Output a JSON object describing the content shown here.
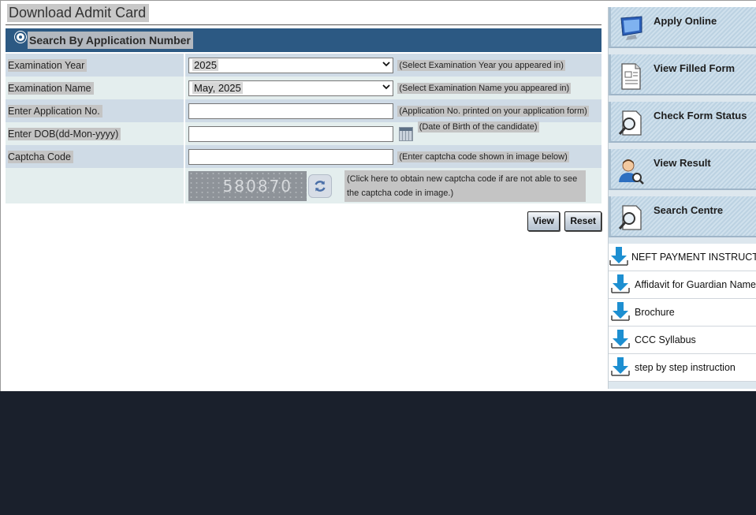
{
  "title": "Download Admit Card",
  "search_by": "Search By Application Number",
  "fields": [
    {
      "label": "Examination Year",
      "value": "2025",
      "hint": "(Select Examination Year you appeared in)"
    },
    {
      "label": "Examination Name",
      "value": "May, 2025",
      "hint": "(Select Examination Name you appeared in)"
    },
    {
      "label": "Enter Application No.",
      "value": "",
      "hint": "(Application No. printed on your application form)"
    },
    {
      "label": "Enter DOB(dd-Mon-yyyy)",
      "value": "",
      "hint": "(Date of Birth of the candidate)"
    },
    {
      "label": "Captcha Code",
      "value": "",
      "hint": "(Enter captcha code shown in image below)"
    }
  ],
  "captcha": {
    "code": "580870",
    "hint": "(Click here to obtain new captcha code if are not able to see the captcha code in image.)"
  },
  "buttons": {
    "view": "View",
    "reset": "Reset"
  },
  "sidebar": {
    "buttons": [
      {
        "label": "Apply Online",
        "icon": "monitor-icon"
      },
      {
        "label": "View Filled Form",
        "icon": "document-icon"
      },
      {
        "label": "Check Form Status",
        "icon": "search-document-icon"
      },
      {
        "label": "View Result",
        "icon": "user-search-icon"
      },
      {
        "label": "Search Centre",
        "icon": "search-document-icon"
      }
    ],
    "downloads": [
      {
        "label": "NEFT PAYMENT INSTRUCTIONS"
      },
      {
        "label": "Affidavit for Guardian Name"
      },
      {
        "label": "Brochure"
      },
      {
        "label": "CCC Syllabus"
      },
      {
        "label": "step by step instruction"
      }
    ]
  },
  "colors": {
    "header_bar": "#2c5983",
    "row_blue": "#cfdbe6",
    "row_light": "#e4eeee",
    "footer_bg": "#1a202c"
  }
}
